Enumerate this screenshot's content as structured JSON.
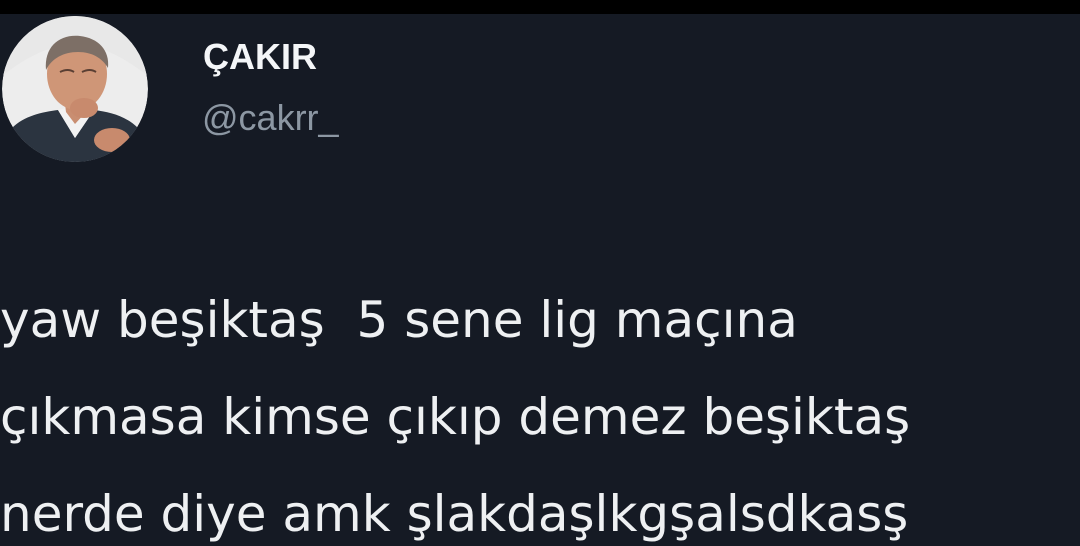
{
  "tweet": {
    "author": {
      "display_name": "ÇAKIR",
      "handle": "@cakrr_",
      "avatar_icon": "profile-photo"
    },
    "text_lines": [
      "yaw beşiktaş  5 sene lig maçına",
      "çıkmasa kimse çıkıp demez beşiktaş",
      "nerde diye amk şlakdaşlkgşalsdkasş"
    ]
  },
  "colors": {
    "background": "#151a24",
    "border": "#000000",
    "text": "#eef0f2",
    "handle": "#8c97a3"
  }
}
